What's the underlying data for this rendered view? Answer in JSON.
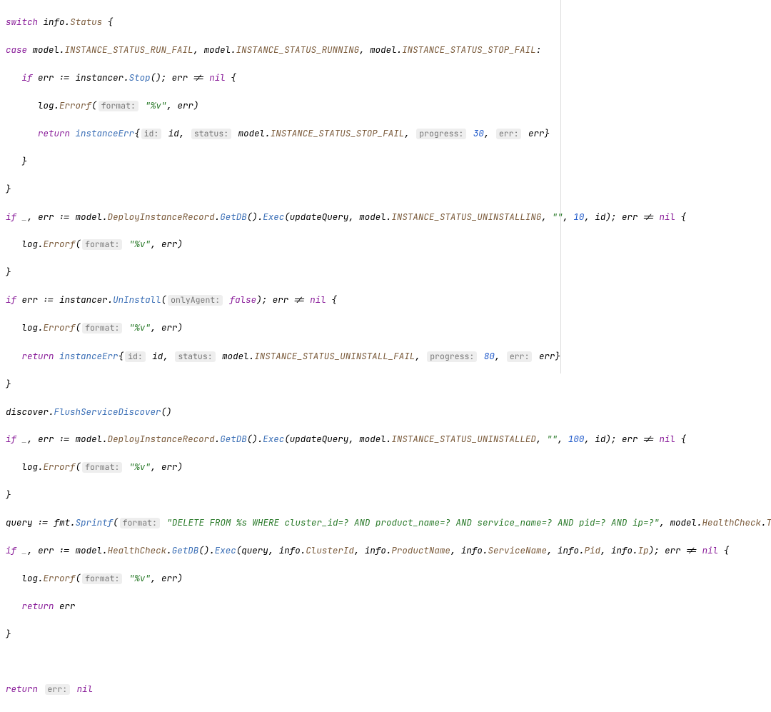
{
  "code": {
    "l1_switch": "switch",
    "l1_info": "info",
    "l1_dot": ".",
    "l1_status": "Status",
    "l1_brace": " {",
    "l2_case": "case",
    "l2_model1": " model",
    "l2_c1": "INSTANCE_STATUS_RUN_FAIL",
    "l2_model2": "model",
    "l2_c2": "INSTANCE_STATUS_RUNNING",
    "l2_model3": "model",
    "l2_c3": "INSTANCE_STATUS_STOP_FAIL",
    "l2_colon": ":",
    "l3_if": "if",
    "l3_err": "err",
    "l3_assign": ":=",
    "l3_instancer": "instancer",
    "l3_stop": "Stop",
    "l3_errne": "err != ",
    "l3_nil": "nil",
    "l4_log": "log",
    "l4_errorf": "Errorf",
    "l4_fmt_param": "format:",
    "l4_fmt": "\"%v\"",
    "l4_err": "err",
    "l5_return": "return",
    "l5_instanceerr": "instanceErr",
    "l5_id_param": "id:",
    "l5_id": "id",
    "l5_status_param": "status:",
    "l5_model": "model",
    "l5_status": "INSTANCE_STATUS_STOP_FAIL",
    "l5_progress_param": "progress:",
    "l5_progress": "30",
    "l5_err_param": "err:",
    "l5_err": "err",
    "l6_brace": "}",
    "l7_brace": "}",
    "l8_if": "if",
    "l8_blank": "_",
    "l8_err": "err",
    "l8_assign": ":=",
    "l8_model": "model",
    "l8_dir": "DeployInstanceRecord",
    "l8_getdb": "GetDB",
    "l8_exec": "Exec",
    "l8_updatequery": "updateQuery",
    "l8_model2": "model",
    "l8_status": "INSTANCE_STATUS_UNINSTALLING",
    "l8_empty": "\"\"",
    "l8_ten": "10",
    "l8_id": "id",
    "l8_errne": "err != ",
    "l8_nil": "nil",
    "l9_log": "log",
    "l9_errorf": "Errorf",
    "l9_fmt_param": "format:",
    "l9_fmt": "\"%v\"",
    "l9_err": "err",
    "l10_brace": "}",
    "l11_if": "if",
    "l11_err": "err",
    "l11_assign": ":=",
    "l11_instancer": "instancer",
    "l11_uninstall": "UnInstall",
    "l11_onlyagent_param": "onlyAgent:",
    "l11_false": "false",
    "l11_errne": "err != ",
    "l11_nil": "nil",
    "l12_log": "log",
    "l12_errorf": "Errorf",
    "l12_fmt_param": "format:",
    "l12_fmt": "\"%v\"",
    "l12_err": "err",
    "l13_return": "return",
    "l13_instanceerr": "instanceErr",
    "l13_id_param": "id:",
    "l13_id": "id",
    "l13_status_param": "status:",
    "l13_model": "model",
    "l13_status": "INSTANCE_STATUS_UNINSTALL_FAIL",
    "l13_progress_param": "progress:",
    "l13_progress": "80",
    "l13_err_param": "err:",
    "l13_err": "err",
    "l14_brace": "}",
    "l15_discover": "discover",
    "l15_flush": "FlushServiceDiscover",
    "l16_if": "if",
    "l16_blank": "_",
    "l16_err": "err",
    "l16_assign": ":=",
    "l16_model": "model",
    "l16_dir": "DeployInstanceRecord",
    "l16_getdb": "GetDB",
    "l16_exec": "Exec",
    "l16_updatequery": "updateQuery",
    "l16_model2": "model",
    "l16_status": "INSTANCE_STATUS_UNINSTALLED",
    "l16_empty": "\"\"",
    "l16_hundred": "100",
    "l16_id": "id",
    "l16_errne": "err != ",
    "l16_nil": "nil",
    "l17_log": "log",
    "l17_errorf": "Errorf",
    "l17_fmt_param": "format:",
    "l17_fmt": "\"%v\"",
    "l17_err": "err",
    "l18_brace": "}",
    "l19_query": "query",
    "l19_assign": ":=",
    "l19_fmt": "fmt",
    "l19_sprintf": "Sprintf",
    "l19_fmt_param": "format:",
    "l19_str": "\"DELETE FROM %s WHERE cluster_id=? AND product_name=? AND service_name=? AND pid=? AND ip=?\"",
    "l19_model": "model",
    "l19_hc": "HealthCheck",
    "l19_tn": "TableName",
    "l20_if": "if",
    "l20_blank": "_",
    "l20_err": "err",
    "l20_assign": ":=",
    "l20_model": "model",
    "l20_hc": "HealthCheck",
    "l20_getdb": "GetDB",
    "l20_exec": "Exec",
    "l20_query": "query",
    "l20_info": "info",
    "l20_cid": "ClusterId",
    "l20_pn": "ProductName",
    "l20_sn": "ServiceName",
    "l20_pid": "Pid",
    "l20_ip": "Ip",
    "l20_errne": "err != ",
    "l20_nil": "nil",
    "l21_log": "log",
    "l21_errorf": "Errorf",
    "l21_fmt_param": "format:",
    "l21_fmt": "\"%v\"",
    "l21_err": "err",
    "l22_return": "return",
    "l22_err": "err",
    "l23_brace": "}",
    "l25_return": "return",
    "l25_err_param": "err:",
    "l25_nil": "nil"
  }
}
